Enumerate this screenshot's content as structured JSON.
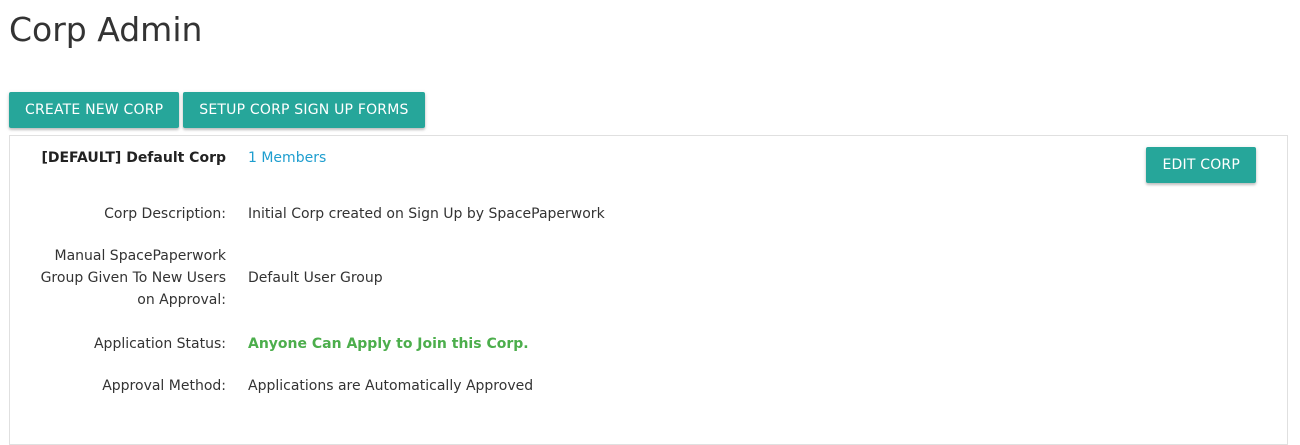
{
  "page": {
    "title": "Corp Admin"
  },
  "toolbar": {
    "create_label": "CREATE NEW CORP",
    "setup_label": "SETUP CORP SIGN UP FORMS"
  },
  "corp": {
    "name": "[DEFAULT] Default Corp",
    "members_link": "1 Members",
    "edit_label": "EDIT CORP",
    "fields": {
      "description_label": "Corp Description:",
      "description_value": "Initial Corp created on Sign Up by SpacePaperwork",
      "group_label_line1": "Manual SpacePaperwork",
      "group_label_line2": "Group Given To New Users",
      "group_label_line3": "on Approval:",
      "group_value": "Default User Group",
      "status_label": "Application Status:",
      "status_value": "Anyone Can Apply to Join this Corp.",
      "approval_label": "Approval Method:",
      "approval_value": "Applications are Automatically Approved"
    }
  },
  "colors": {
    "accent": "#26a69a",
    "link": "#1e9ecf",
    "status_green": "#4cae4c"
  }
}
